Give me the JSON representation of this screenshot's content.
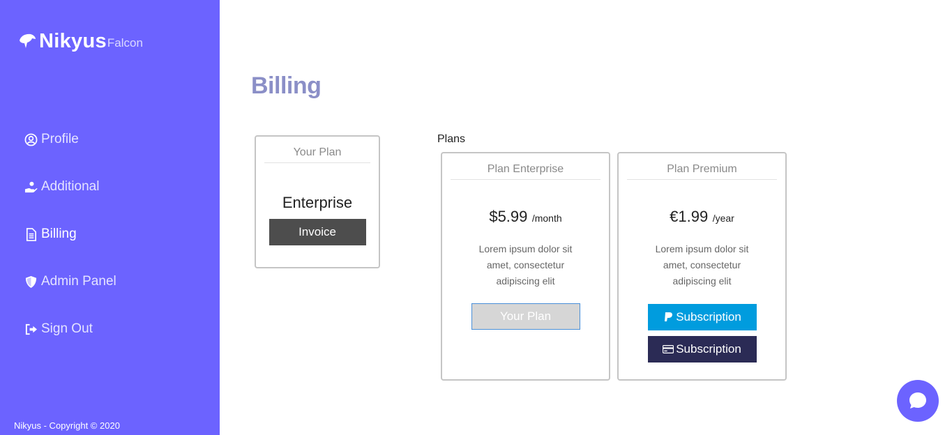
{
  "brand": {
    "name": "Nikyus",
    "sub": "Falcon"
  },
  "sidebar": {
    "items": [
      {
        "label": "Profile",
        "icon": "user-circle-icon"
      },
      {
        "label": "Additional",
        "icon": "hand-user-icon"
      },
      {
        "label": "Billing",
        "icon": "file-icon",
        "active": true
      },
      {
        "label": "Admin Panel",
        "icon": "shield-icon"
      },
      {
        "label": "Sign Out",
        "icon": "sign-out-icon"
      }
    ],
    "copyright": "Nikyus - Copyright © 2020"
  },
  "page": {
    "title": "Billing"
  },
  "your_plan": {
    "header": "Your Plan",
    "name": "Enterprise",
    "invoice_label": "Invoice"
  },
  "plans": {
    "label": "Plans",
    "enterprise": {
      "header": "Plan Enterprise",
      "price": "$5.99",
      "period": "/month",
      "description": "Lorem ipsum dolor sit amet, consectetur adipiscing elit",
      "button_label": "Your Plan"
    },
    "premium": {
      "header": "Plan Premium",
      "price": "€1.99",
      "period": "/year",
      "description": "Lorem ipsum dolor sit amet, consectetur adipiscing elit",
      "paypal_label": "Subscription",
      "card_label": "Subscription"
    }
  },
  "colors": {
    "sidebar": "#6c63ff",
    "title": "#8b8fc7",
    "invoice": "#4d4d4d",
    "paypal": "#009cde",
    "card": "#2b2b55",
    "chat": "#6c63ff"
  }
}
